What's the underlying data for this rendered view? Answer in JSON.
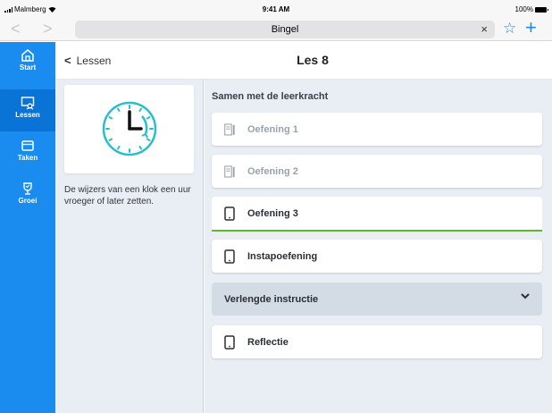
{
  "status_bar": {
    "carrier": "Malmberg",
    "time": "9:41 AM",
    "battery": "100%"
  },
  "browser": {
    "url_title": "Bingel",
    "back_glyph": "<",
    "forward_glyph": ">",
    "clear_glyph": "×",
    "bookmark_glyph": "☆",
    "add_glyph": "+"
  },
  "sidebar": {
    "items": [
      {
        "label": "Start",
        "icon": "home-icon",
        "active": false
      },
      {
        "label": "Lessen",
        "icon": "lessons-icon",
        "active": true
      },
      {
        "label": "Taken",
        "icon": "tasks-icon",
        "active": false
      },
      {
        "label": "Groei",
        "icon": "trophy-icon",
        "active": false
      }
    ]
  },
  "header": {
    "back_label": "Lessen",
    "title": "Les 8"
  },
  "lesson": {
    "description": "De wijzers van een klok een uur vroeger of later zetten.",
    "illustration": "clock-icon"
  },
  "section": {
    "heading": "Samen met de leerkracht"
  },
  "exercises": [
    {
      "label": "Oefening 1",
      "state": "locked",
      "icon": "worksheet-icon"
    },
    {
      "label": "Oefening 2",
      "state": "locked",
      "icon": "worksheet-icon"
    },
    {
      "label": "Oefening 3",
      "state": "current",
      "icon": "tablet-icon"
    },
    {
      "label": "Instapoefening",
      "state": "available",
      "icon": "tablet-icon"
    }
  ],
  "expander": {
    "label": "Verlengde instructie",
    "icon": "chevron-down-icon"
  },
  "reflection": {
    "label": "Reflectie",
    "icon": "tablet-icon"
  },
  "colors": {
    "accent": "#1a8cf0",
    "sidebar_active": "#0a73d6",
    "progress": "#5cb82d",
    "clock": "#2bbdcc"
  }
}
